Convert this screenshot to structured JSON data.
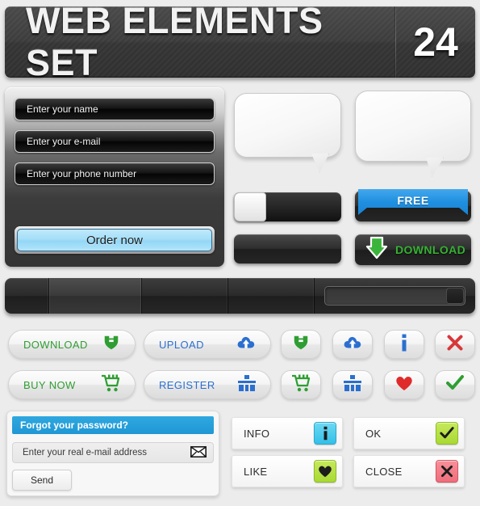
{
  "header": {
    "title": "WEB ELEMENTS SET",
    "number": "24"
  },
  "form_panel": {
    "fields": [
      {
        "name": "name",
        "placeholder": "Enter your name"
      },
      {
        "name": "email",
        "placeholder": "Enter your e-mail"
      },
      {
        "name": "phone",
        "placeholder": "Enter your phone number"
      }
    ],
    "submit_label": "Order now"
  },
  "promo": {
    "free_label": "FREE",
    "download_label": "DOWNLOAD"
  },
  "pills": [
    {
      "label": "DOWNLOAD",
      "icon": "download-shield-icon",
      "color": "#2f9e32"
    },
    {
      "label": "UPLOAD",
      "icon": "upload-cloud-icon",
      "color": "#2b6fd0"
    },
    {
      "label": "BUY NOW",
      "icon": "shopping-cart-icon",
      "color": "#2f9e32"
    },
    {
      "label": "REGISTER",
      "icon": "register-blocks-icon",
      "color": "#2b6fd0"
    }
  ],
  "icon_buttons_row1": [
    {
      "icon": "download-shield-icon",
      "color": "#2f9e32"
    },
    {
      "icon": "upload-cloud-icon",
      "color": "#2b6fd0"
    },
    {
      "icon": "info-i-icon",
      "color": "#2b6fd0"
    },
    {
      "icon": "close-x-icon",
      "color": "#d8373a"
    }
  ],
  "icon_buttons_row2": [
    {
      "icon": "shopping-cart-icon",
      "color": "#2f9e32"
    },
    {
      "icon": "register-blocks-icon",
      "color": "#2b6fd0"
    },
    {
      "icon": "heart-icon",
      "color": "#e02b2b"
    },
    {
      "icon": "check-icon",
      "color": "#2f9e32"
    }
  ],
  "forgot_password": {
    "title": "Forgot your password?",
    "email_placeholder": "Enter your real e-mail address",
    "email_icon": "envelope-icon",
    "send_label": "Send"
  },
  "flat_buttons": [
    {
      "label": "INFO",
      "icon": "info-i-icon",
      "chip": "cyan"
    },
    {
      "label": "OK",
      "icon": "check-icon",
      "chip": "lime"
    },
    {
      "label": "LIKE",
      "icon": "heart-icon",
      "chip": "lime"
    },
    {
      "label": "CLOSE",
      "icon": "close-x-icon",
      "chip": "pink"
    }
  ],
  "colors": {
    "background": "#ececec",
    "accent_blue": "#1f8fe0",
    "accent_green": "#2f9e32",
    "header_dark": "#3d3d3d"
  }
}
